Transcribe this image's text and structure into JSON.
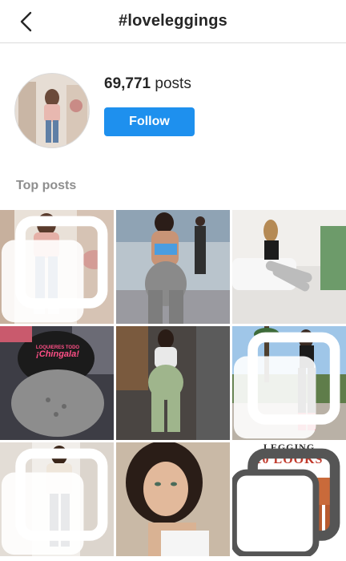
{
  "header": {
    "title": "#loveleggings",
    "back_icon": "chevron-left-icon"
  },
  "profile": {
    "posts_count": "69,771",
    "posts_label": "posts",
    "follow_label": "Follow"
  },
  "section": {
    "title": "Top posts"
  },
  "tiles": [
    {
      "name": "post-1",
      "multi": true
    },
    {
      "name": "post-2",
      "multi": false
    },
    {
      "name": "post-3",
      "multi": false
    },
    {
      "name": "post-4",
      "multi": false,
      "shirt_text_1": "LOQUIERES TODO",
      "shirt_text_2": "¡Chingala!"
    },
    {
      "name": "post-5",
      "multi": false
    },
    {
      "name": "post-6",
      "multi": true
    },
    {
      "name": "post-7",
      "multi": true
    },
    {
      "name": "post-8",
      "multi": false
    },
    {
      "name": "post-9",
      "multi": true,
      "headline_1": "LEGGING",
      "headline_2": "10 LOOKS"
    }
  ],
  "colors": {
    "accent": "#1e90ee",
    "muted": "#8e8e8e",
    "text": "#262626",
    "divider": "#dbdbdb"
  }
}
